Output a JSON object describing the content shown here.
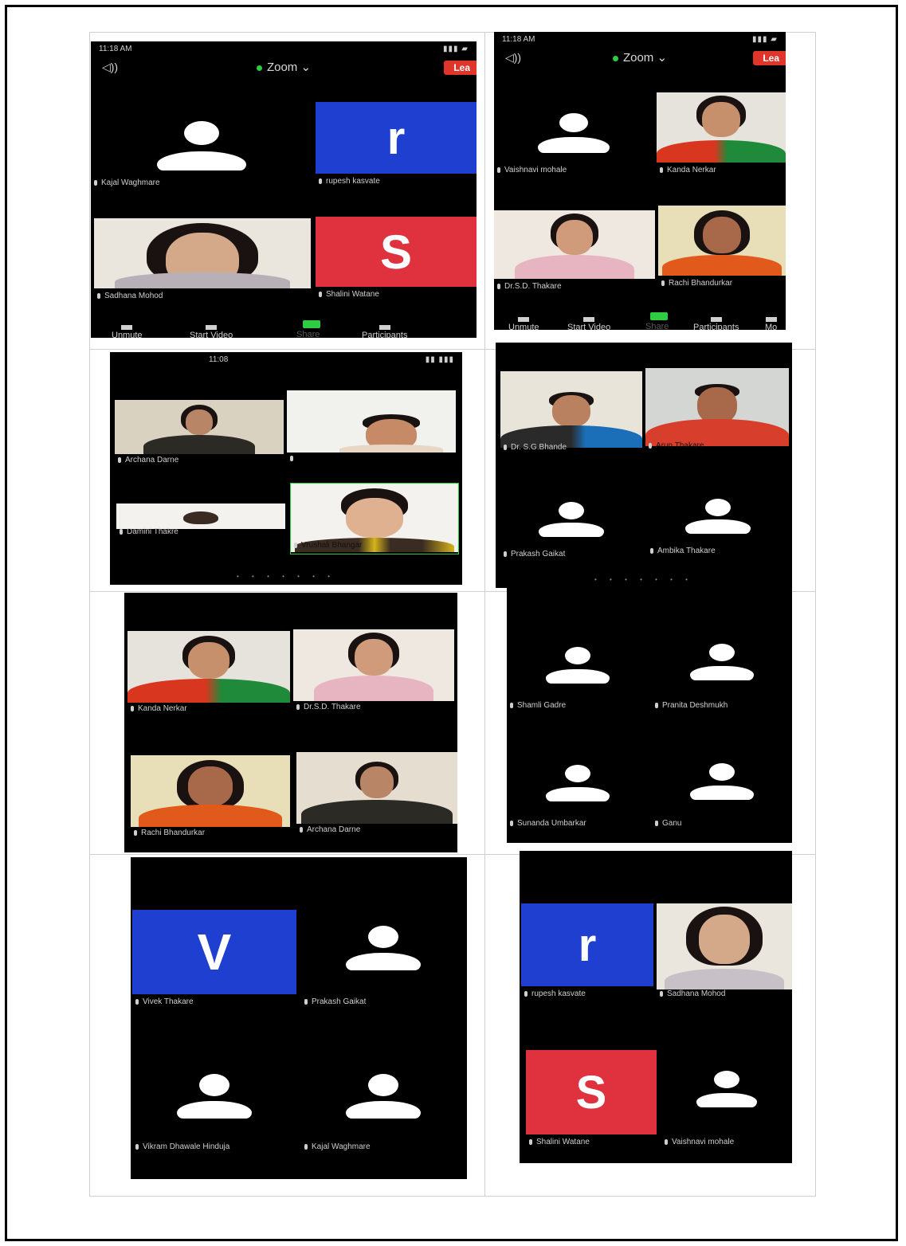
{
  "screenshots": {
    "s1": {
      "status_time": "11:18 AM",
      "app_name": "Zoom",
      "leave_label": "Lea",
      "tiles": [
        {
          "name": "Kajal Waghmare"
        },
        {
          "name": "rupesh kasvate",
          "letter": "r"
        },
        {
          "name": "Sadhana Mohod"
        },
        {
          "name": "Shalini Watane",
          "letter": "S"
        }
      ],
      "toolbar": {
        "unmute": "Unmute",
        "start_video": "Start Video",
        "share": "Share",
        "participants": "Participants"
      }
    },
    "s2": {
      "status_time": "11:18 AM",
      "app_name": "Zoom",
      "leave_label": "Lea",
      "tiles": [
        {
          "name": "Vaishnavi mohale"
        },
        {
          "name": "Kanda Nerkar"
        },
        {
          "name": "Dr.S.D. Thakare"
        },
        {
          "name": "Rachi Bhandurkar"
        }
      ],
      "toolbar": {
        "unmute": "Unmute",
        "start_video": "Start Video",
        "share": "Share",
        "participants": "Participants",
        "more": "Mo"
      }
    },
    "s3": {
      "status_time": "11:08",
      "tiles": [
        {
          "name": "Archana Darne"
        },
        {
          "name": ""
        },
        {
          "name": "Damini Thakre"
        },
        {
          "name": "Vrushali Bhangar"
        }
      ]
    },
    "s4": {
      "tiles": [
        {
          "name": "Dr. S.G.Bhande"
        },
        {
          "name": "Arun Thakare"
        },
        {
          "name": "Prakash Gaikat"
        },
        {
          "name": "Ambika Thakare"
        }
      ]
    },
    "s5": {
      "tiles": [
        {
          "name": "Kanda Nerkar"
        },
        {
          "name": "Dr.S.D. Thakare"
        },
        {
          "name": "Rachi Bhandurkar"
        },
        {
          "name": "Archana Darne"
        }
      ]
    },
    "s6": {
      "tiles": [
        {
          "name": "Shamli Gadre"
        },
        {
          "name": "Pranita Deshmukh"
        },
        {
          "name": "Sunanda Umbarkar"
        },
        {
          "name": "Ganu"
        }
      ]
    },
    "s7": {
      "tiles": [
        {
          "name": "Vivek Thakare",
          "letter": "V"
        },
        {
          "name": "Prakash Gaikat"
        },
        {
          "name": "Vikram Dhawale Hinduja"
        },
        {
          "name": "Kajal Waghmare"
        }
      ]
    },
    "s8": {
      "tiles": [
        {
          "name": "rupesh kasvate",
          "letter": "r"
        },
        {
          "name": "Sadhana Mohod"
        },
        {
          "name": "Shalini Watane",
          "letter": "S"
        },
        {
          "name": "Vaishnavi mohale"
        }
      ]
    }
  },
  "colors": {
    "letter_blue": "#1f3fd0",
    "letter_red": "#e0323e",
    "zoom_green": "#2ecc40",
    "leave_red": "#e0352b"
  }
}
